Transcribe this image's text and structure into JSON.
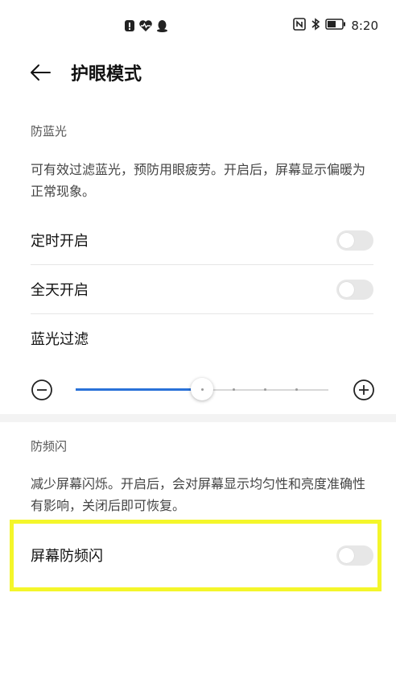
{
  "status_bar": {
    "time": "8:20",
    "center_icons": [
      "notification-alert-icon",
      "health-heart-icon",
      "qq-penguin-icon"
    ],
    "right_icons": [
      "nfc-icon",
      "bluetooth-icon",
      "battery-icon"
    ]
  },
  "header": {
    "title": "护眼模式",
    "back_icon": "arrow-left-icon"
  },
  "blue_light": {
    "section_title": "防蓝光",
    "description": "可有效过滤蓝光，预防用眼疲劳。开启后，屏幕显示偏暖为正常现象。",
    "scheduled_label": "定时开启",
    "scheduled_on": false,
    "all_day_label": "全天开启",
    "all_day_on": false,
    "filter_label": "蓝光过滤",
    "filter_level": 0.5
  },
  "anti_flicker": {
    "section_title": "防频闪",
    "description": "减少屏幕闪烁。开启后，会对屏幕显示均匀性和亮度准确性有影响，关闭后即可恢复。",
    "toggle_label": "屏幕防频闪",
    "toggle_on": false
  },
  "colors": {
    "accent": "#2a72d8",
    "highlight": "#f4f62a",
    "toggle_off": "#e7e7e7"
  }
}
